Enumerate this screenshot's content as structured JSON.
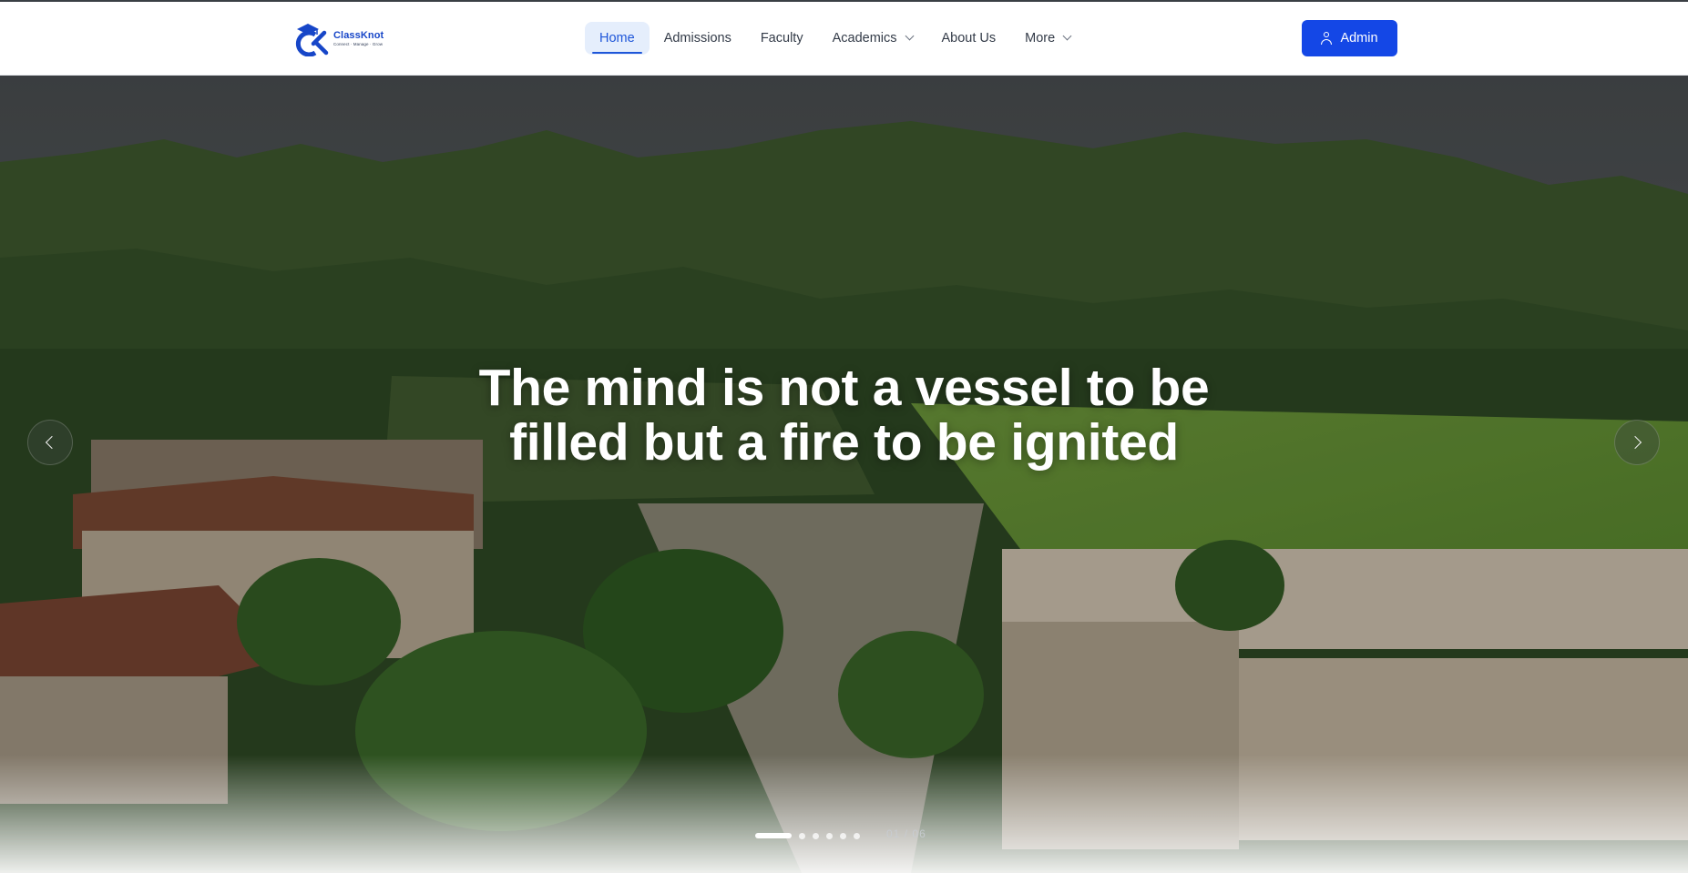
{
  "brand": {
    "name": "ClassKnot",
    "tagline": "Connect · Manage · Grow",
    "icon": "classknot-logo-icon",
    "color": "#1746c8"
  },
  "nav": {
    "items": [
      {
        "label": "Home",
        "active": true,
        "has_dropdown": false
      },
      {
        "label": "Admissions",
        "active": false,
        "has_dropdown": false
      },
      {
        "label": "Faculty",
        "active": false,
        "has_dropdown": false
      },
      {
        "label": "Academics",
        "active": false,
        "has_dropdown": true
      },
      {
        "label": "About Us",
        "active": false,
        "has_dropdown": false
      },
      {
        "label": "More",
        "active": false,
        "has_dropdown": true
      }
    ],
    "active_color": "#1e56d9",
    "active_bg": "#e5eefc"
  },
  "admin_button": {
    "label": "Admin",
    "icon": "user-icon",
    "color": "#1447e6"
  },
  "hero": {
    "quote": "The mind is not a vessel to be filled but a fire to be ignited",
    "prev_icon": "chevron-left-icon",
    "next_icon": "chevron-right-icon",
    "slide_count": 6,
    "current_slide": 1,
    "counter_current": "01",
    "counter_separator": "/",
    "counter_total": "06"
  }
}
